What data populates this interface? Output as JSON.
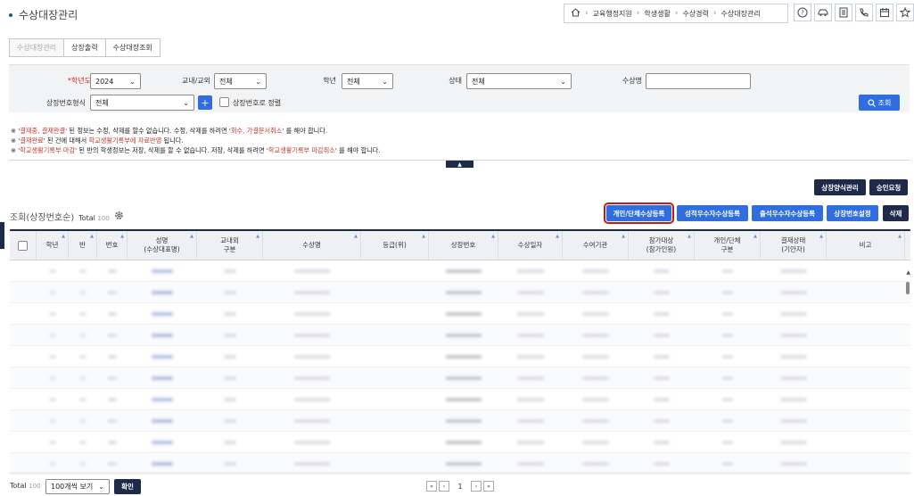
{
  "page": {
    "title": "수상대장관리"
  },
  "breadcrumb": [
    "교육행정지원",
    "학생생활",
    "수상경력",
    "수상대장관리"
  ],
  "toolbar_icons": [
    "help-icon",
    "car-icon",
    "document-icon",
    "phone-icon",
    "calendar-icon",
    "star-icon"
  ],
  "tabs": [
    {
      "label": "수상대장관리",
      "active": true
    },
    {
      "label": "상장출력",
      "active": false
    },
    {
      "label": "수상대장조회",
      "active": false
    }
  ],
  "search": {
    "year_label": "학년도",
    "year_value": "2024",
    "inout_label": "교내/교외",
    "inout_value": "전체",
    "grade_label": "학년",
    "grade_value": "전체",
    "status_label": "상태",
    "status_value": "전체",
    "award_name_label": "수상명",
    "award_name_value": "",
    "format_label": "상장번호형식",
    "format_value": "전체",
    "plus_label": "+",
    "sort_checkbox_label": "상장번호로 정렬",
    "search_button": "조회"
  },
  "notices": [
    {
      "prefix": "※ '",
      "red1": "결재중, 결재완결",
      "mid": "' 된 정보는 수정, 삭제를 할수 없습니다. 수정, 삭제를 하려면 '",
      "red2": "회수, 가결문서취소",
      "suffix": "' 를 해야 합니다."
    },
    {
      "prefix": "※ '",
      "red1": "결재완료",
      "mid": "' 된 건에 대해서 ",
      "red2": "학교생활기록부에 자료반영",
      "suffix": " 됩니다."
    },
    {
      "prefix": "※ '",
      "red1": "학교생활기록부 마감",
      "mid": "' 된 반의 학생정보는 저장, 삭제를 할 수 없습니다. 저장, 삭제를 하려면 '",
      "red2": "학교생활기록부 마감취소",
      "suffix": "' 를 해야 합니다."
    }
  ],
  "collapse_label": "▲",
  "top_buttons": {
    "form_mgmt": "상장양식관리",
    "approval_req": "승인요청"
  },
  "list": {
    "title": "조회(상장번호순)",
    "total_label": "Total",
    "total_value": "100"
  },
  "action_buttons": {
    "individual_group": "개인/단체수상등록",
    "grade_excellent": "성적우수자수상등록",
    "attendance_excellent": "출석우수자수상등록",
    "number_setting": "상장번호설정",
    "delete": "삭제"
  },
  "table": {
    "columns": [
      "",
      "학년",
      "반",
      "번호",
      "성명\n(수상대표명)",
      "교내외\n구분",
      "수상명",
      "등급(위)",
      "상장번호",
      "수상일자",
      "수여기관",
      "참가대상\n(참가인원)",
      "개인/단체\n구분",
      "결재상태\n(기안자)",
      "비고"
    ]
  },
  "footer": {
    "total_label": "Total",
    "total_value": "100",
    "page_size": "100개씩 보기",
    "confirm": "확인",
    "current_page": "1"
  },
  "colors": {
    "accent_blue": "#2f6de0",
    "dark_navy": "#1e2a4a",
    "highlight_red": "#c21a1a"
  }
}
